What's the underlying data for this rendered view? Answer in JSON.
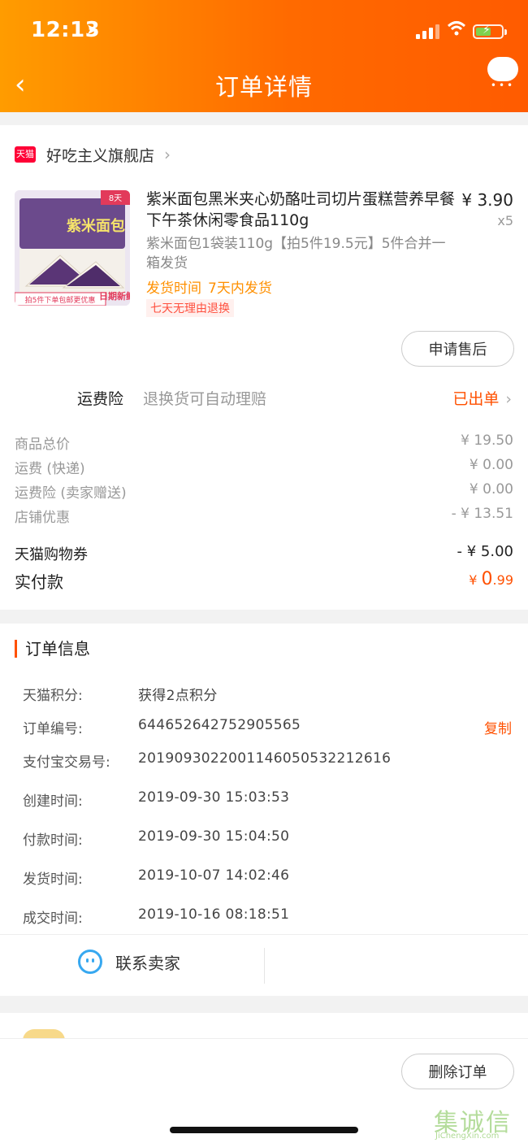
{
  "status_bar": {
    "time": "12:13",
    "location_arrow": "➤"
  },
  "nav": {
    "back_icon": "‹",
    "title": "订单详情",
    "more_icon": "chat-more-icon"
  },
  "shop": {
    "badge": "天猫",
    "name": "好吃主义旗舰店",
    "arrow": "›"
  },
  "product": {
    "title": "紫米面包黑米夹心奶酪吐司切片蛋糕营养早餐下午茶休闲零食品110g",
    "price": "¥ 3.90",
    "qty": "x5",
    "sku": "紫米面包1袋装110g【拍5件19.5元】5件合并一箱发货",
    "ship_label": "发货时间",
    "ship_value": "7天内发货",
    "return_tag": "七天无理由退换",
    "image": {
      "corner_badge": "8天",
      "brand": "紫米面包",
      "banner": "拍5件下单包邮更优惠",
      "fresh": "日期新鲜"
    }
  },
  "buttons": {
    "after_sale": "申请售后",
    "delete_order": "删除订单"
  },
  "insurance": {
    "label": "运费险",
    "desc": "退换货可自动理赔",
    "status": "已出单",
    "arrow": "›"
  },
  "price_summary": [
    {
      "label": "商品总价",
      "value": "¥ 19.50"
    },
    {
      "label": "运费 (快递)",
      "value": "¥ 0.00"
    },
    {
      "label": "运费险 (卖家赠送)",
      "value": "¥ 0.00"
    },
    {
      "label": "店铺优惠",
      "value": "- ¥ 13.51"
    }
  ],
  "coupon": {
    "label": "天猫购物券",
    "value": "- ¥ 5.00"
  },
  "paid": {
    "label": "实付款",
    "currency": "¥ ",
    "int": "0",
    "dec": ".99"
  },
  "order_info": {
    "title": "订单信息",
    "rows": [
      {
        "k": "天猫积分:",
        "v": "获得2点积分"
      },
      {
        "k": "订单编号:",
        "v": "644652642752905565"
      },
      {
        "k": "支付宝交易号:",
        "v": "2019093022001146050532212616"
      },
      {
        "k": "创建时间:",
        "v": "2019-09-30 15:03:53"
      },
      {
        "k": "付款时间:",
        "v": "2019-09-30 15:04:50"
      },
      {
        "k": "发货时间:",
        "v": "2019-10-07 14:02:46"
      },
      {
        "k": "成交时间:",
        "v": "2019-10-16 08:18:51"
      }
    ],
    "copy": "复制"
  },
  "contact": {
    "label": "联系卖家"
  },
  "watermark": {
    "cn": "集诚信",
    "en": "JiChengXin.com"
  },
  "colors": {
    "accent": "#ff5000",
    "header_start": "#ff9c00",
    "header_end": "#ff5b00",
    "ship": "#ff9000"
  }
}
